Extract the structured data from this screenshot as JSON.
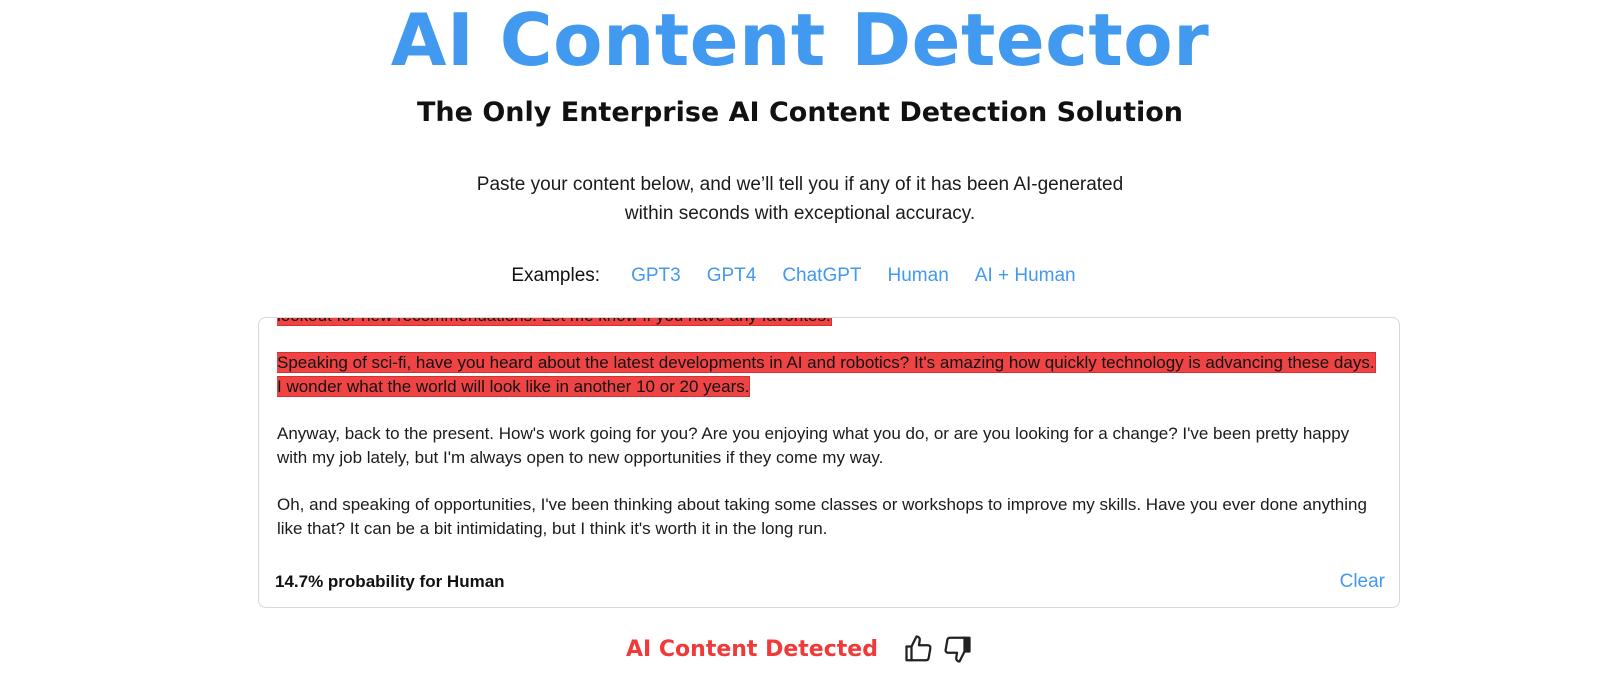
{
  "hero": {
    "title": "AI Content Detector",
    "subtitle": "The Only Enterprise AI Content Detection Solution"
  },
  "intro": {
    "line1": "Paste your content below, and we’ll tell you if any of it has been AI-generated",
    "line2": "within seconds with exceptional accuracy."
  },
  "examples": {
    "label": "Examples:",
    "links": [
      "GPT3",
      "GPT4",
      "ChatGPT",
      "Human",
      "AI + Human"
    ]
  },
  "editor": {
    "paragraphs": [
      {
        "text": "lookout for new recommendations. Let me know if you have any favorites!",
        "ai_flagged": true
      },
      {
        "text": "Speaking of sci-fi, have you heard about the latest developments in AI and robotics? It's amazing how quickly technology is advancing these days. I wonder what the world will look like in another 10 or 20 years.",
        "ai_flagged": true
      },
      {
        "text": "Anyway, back to the present. How's work going for you? Are you enjoying what you do, or are you looking for a change? I've been pretty happy with my job lately, but I'm always open to new opportunities if they come my way.",
        "ai_flagged": false
      },
      {
        "text": "Oh, and speaking of opportunities, I've been thinking about taking some classes or workshops to improve my skills. Have you ever done anything like that? It can be a bit intimidating, but I think it's worth it in the long run.",
        "ai_flagged": false
      }
    ],
    "probability_text": "14.7% probability for Human",
    "clear_label": "Clear"
  },
  "result": {
    "label": "AI Content Detected",
    "thumbs_up_icon": "thumbs-up-icon",
    "thumbs_down_icon": "thumbs-down-icon"
  },
  "colors": {
    "accent": "#4299f0",
    "ai_highlight": "#f04444",
    "result_red": "#f03a3a"
  }
}
